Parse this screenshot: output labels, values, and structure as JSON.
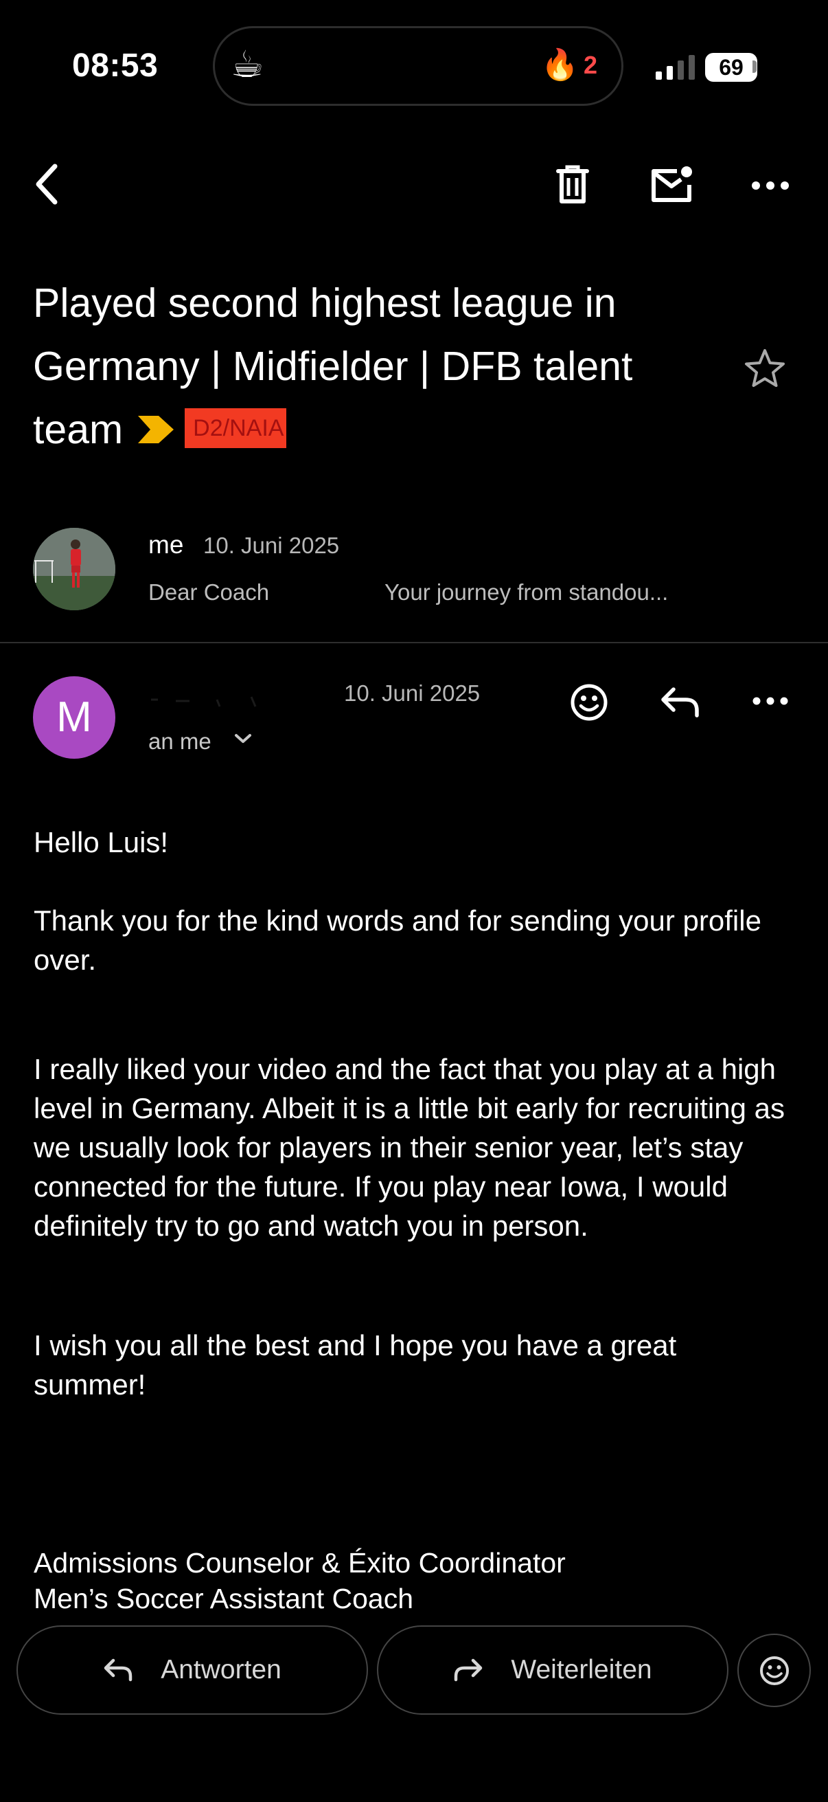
{
  "status_bar": {
    "time": "08:53",
    "streak_count": "2",
    "battery": "69"
  },
  "toolbar": {
    "back_icon": "back-arrow-icon",
    "delete_icon": "trash-icon",
    "mark_unread_icon": "mail-unread-icon",
    "more_icon": "more-horizontal-icon"
  },
  "subject": {
    "text": "Played second highest league in Germany | Midfielder | DFB talent team",
    "label": "D2/NAIA",
    "important_color": "#f4b400"
  },
  "collapsed_message": {
    "sender": "me",
    "date": "10. Juni 2025",
    "snippet_1": "Dear Coach",
    "snippet_2": "Your journey from standou..."
  },
  "expanded_message": {
    "avatar_letter": "M",
    "avatar_color": "#a949c2",
    "date": "10. Juni 2025",
    "to": "an me"
  },
  "body": {
    "greeting": "Hello Luis!",
    "p1": "Thank you for the kind words and for sending your profile over.",
    "p2": "I really liked your video and the fact that you play at a high level in Germany. Albeit it is a little bit early for recruiting as we usually look for players in their senior year, let’s stay connected for the future. If you play near Iowa, I would definitely try to go and watch you in person.",
    "p3": "I wish you all the best and I hope you have a great summer!",
    "sig_line1": "Admissions Counselor & Éxito Coordinator",
    "sig_line2": "Men’s Soccer Assistant Coach"
  },
  "actions": {
    "reply_label": "Antworten",
    "forward_label": "Weiterleiten"
  }
}
